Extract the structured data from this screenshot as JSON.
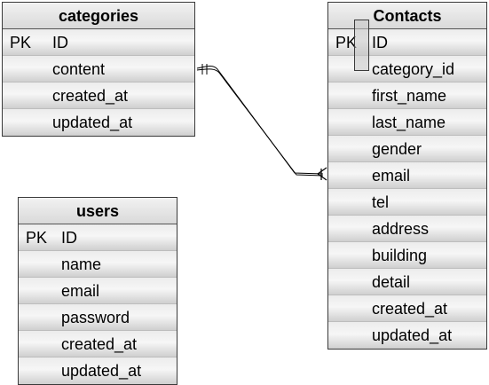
{
  "tables": {
    "categories": {
      "title": "categories",
      "fields": [
        {
          "key": "PK",
          "name": "ID"
        },
        {
          "key": "",
          "name": "content"
        },
        {
          "key": "",
          "name": "created_at"
        },
        {
          "key": "",
          "name": "updated_at"
        }
      ]
    },
    "users": {
      "title": "users",
      "fields": [
        {
          "key": "PK",
          "name": "ID"
        },
        {
          "key": "",
          "name": "name"
        },
        {
          "key": "",
          "name": "email"
        },
        {
          "key": "",
          "name": "password"
        },
        {
          "key": "",
          "name": "created_at"
        },
        {
          "key": "",
          "name": "updated_at"
        }
      ]
    },
    "contacts": {
      "title": "Contacts",
      "fields": [
        {
          "key": "PK",
          "name": "ID"
        },
        {
          "key": "",
          "name": "category_id"
        },
        {
          "key": "",
          "name": "first_name"
        },
        {
          "key": "",
          "name": "last_name"
        },
        {
          "key": "",
          "name": "gender"
        },
        {
          "key": "",
          "name": "email"
        },
        {
          "key": "",
          "name": "tel"
        },
        {
          "key": "",
          "name": "address"
        },
        {
          "key": "",
          "name": "building"
        },
        {
          "key": "",
          "name": "detail"
        },
        {
          "key": "",
          "name": "created_at"
        },
        {
          "key": "",
          "name": "updated_at"
        }
      ]
    }
  },
  "relationships": [
    {
      "from_table": "categories",
      "from_field": "content",
      "to_table": "contacts",
      "to_field": "email",
      "from_end": "one",
      "to_end": "many"
    }
  ],
  "colors": {
    "border": "#3a3a3a",
    "line": "#000000"
  }
}
